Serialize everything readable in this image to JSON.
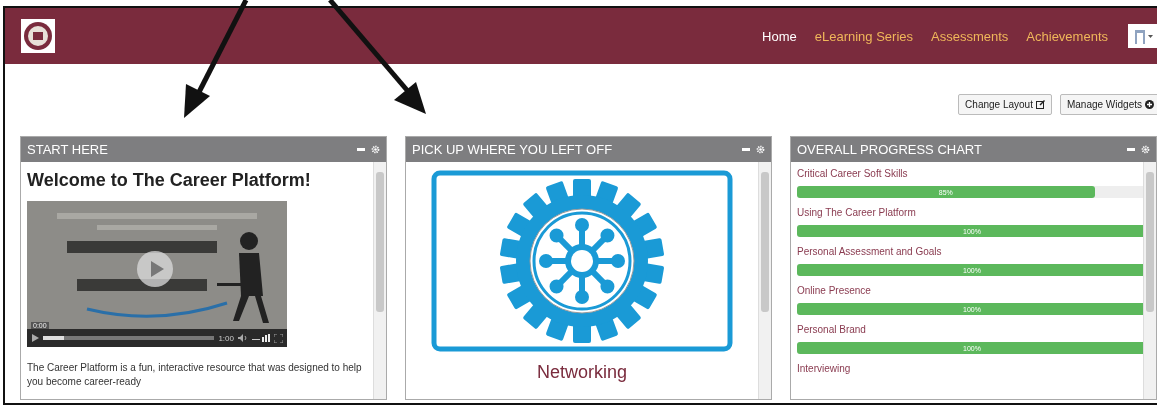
{
  "navbar": {
    "links": [
      {
        "label": "Home",
        "selected": true
      },
      {
        "label": "eLearning Series",
        "selected": false
      },
      {
        "label": "Assessments",
        "selected": false
      },
      {
        "label": "Achievements",
        "selected": false
      }
    ]
  },
  "toolbar": {
    "buttons": [
      "Change Layout",
      "Manage Widgets"
    ]
  },
  "widgets": [
    {
      "kind": "welcome",
      "title": "START HERE",
      "heading": "Welcome to The Career Platform!",
      "video": {
        "current": "0:00",
        "duration": "1:00",
        "level": 0.12
      },
      "text": "The Career Platform is a fun, interactive resource that was designed to help you become career-ready"
    },
    {
      "kind": "module",
      "title": "PICK UP WHERE YOU LEFT OFF",
      "caption": "Networking"
    },
    {
      "kind": "progress",
      "title": "OVERALL PROGRESS CHART",
      "items": [
        {
          "name": "Critical Career Soft Skills",
          "level": 0.85,
          "reading": "85%"
        },
        {
          "name": "Using The Career Platform",
          "level": 1,
          "reading": "100%"
        },
        {
          "name": "Personal Assessment and Goals",
          "level": 1,
          "reading": "100%"
        },
        {
          "name": "Online Presence",
          "level": 1,
          "reading": "100%"
        },
        {
          "name": "Personal Brand",
          "level": 1,
          "reading": "100%"
        },
        {
          "name": "Interviewing"
        }
      ]
    }
  ]
}
